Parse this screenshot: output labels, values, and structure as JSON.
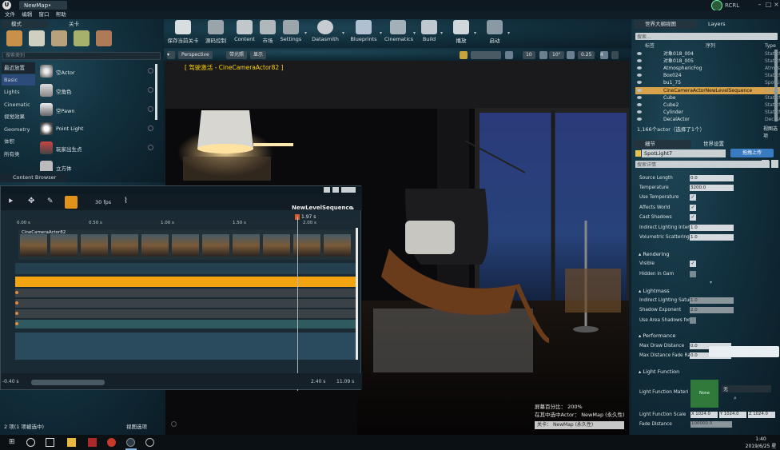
{
  "window": {
    "tab_title": "NewMap•",
    "user": "RCRL",
    "menu": [
      "文件",
      "编辑",
      "窗口",
      "帮助"
    ]
  },
  "modes": {
    "tab_label": "模式",
    "tab2_label": "关卡",
    "search_placeholder": "搜索类别",
    "categories": [
      "最近放置",
      "Basic",
      "Lights",
      "Cinematic",
      "视觉效果",
      "Geometry",
      "体积",
      "所有类"
    ],
    "selected_category": "Basic",
    "items": [
      "空Actor",
      "空角色",
      "空Pawn",
      "Point Light",
      "玩家出生点",
      "立方体"
    ]
  },
  "content_browser": {
    "label": "Content Browser"
  },
  "toolbar": {
    "buttons": [
      "保存当前关卡",
      "源码控制",
      "Content",
      "市场",
      "Settings",
      "Datasmith",
      "Blueprints",
      "Cinematics",
      "Build",
      "播放",
      "启动"
    ]
  },
  "viewport": {
    "perspective": "Perspective",
    "lit": "带光照",
    "show": "显示",
    "cam_label": "[ 驾驶激活 - CineCameraActor82 ]",
    "grid_snap": "10",
    "rot_snap": "10°",
    "scale_snap": "0.25",
    "cam_speed": "4",
    "screen_pct_label": "屏幕百分比：",
    "screen_pct": "200%",
    "selected_label": "在其中选中Actor：",
    "selected_map": "NewMap (永久性)",
    "level_label": "关卡：",
    "level_value": "NewMap (永久性)"
  },
  "sequencer": {
    "name": "NewLevelSequence",
    "fps": "30 fps",
    "time_marker": "1.97 s",
    "ruler": [
      "0.00 s",
      "0.50 s",
      "1.00 s",
      "1.50 s",
      "2.00 s"
    ],
    "track_label": "CineCameraActor82",
    "bottom_left": "-0.40 s",
    "bottom_mid": "2.40 s",
    "bottom_right": "11.09 s",
    "sel_count": "2 项(1 项被选中)",
    "view_options": "视图选项"
  },
  "outliner": {
    "tab": "世界大纲视图",
    "layers_tab": "Layers",
    "search_placeholder": "搜索...",
    "col_label": "标签",
    "col_seq": "序列",
    "col_type": "Type",
    "rows": [
      {
        "name": "对象018_004",
        "type": "StaticM"
      },
      {
        "name": "对象018_005",
        "type": "StaticM"
      },
      {
        "name": "AtmosphericFog",
        "type": "Atmosph"
      },
      {
        "name": "Box024",
        "type": "StaticM"
      },
      {
        "name": "bu1_75",
        "type": "SpotLi"
      },
      {
        "name": "CineCameraActorNewLevelSequence",
        "type": "CineCa"
      },
      {
        "name": "Cube",
        "type": "StaticM"
      },
      {
        "name": "Cube2",
        "type": "StaticM"
      },
      {
        "name": "Cylinder",
        "type": "StaticM"
      },
      {
        "name": "DecalActor",
        "type": "DecalA"
      }
    ],
    "count": "1,166个actor（选择了1个）",
    "view_options": "视图选项"
  },
  "details": {
    "tab": "细节",
    "world_tab": "世界设置",
    "actor_name": "SpotLight7",
    "upload_btn": "拖拽上传",
    "search_placeholder": "搜索详情",
    "props": [
      {
        "label": "Source Length",
        "value": "0.0"
      },
      {
        "label": "Temperature",
        "value": "3200.0"
      },
      {
        "label": "Use Temperature",
        "check": "✓"
      },
      {
        "label": "Affects World",
        "check": "✓"
      },
      {
        "label": "Cast Shadows",
        "check": "✓"
      },
      {
        "label": "Indirect Lighting Intens",
        "value": "1.0"
      },
      {
        "label": "Volumetric Scattering I",
        "value": "1.0"
      }
    ],
    "rendering": "Rendering",
    "visible": "Visible",
    "hidden_in_game": "Hidden in Gam",
    "lightmass": "Lightmass",
    "lm_props": [
      "Indirect Lighting Satura",
      "Shadow Exponent",
      "Use Area Shadows for S"
    ],
    "lm_values": [
      "1.0",
      "2.0"
    ],
    "performance": "Performance",
    "perf_props": [
      {
        "label": "Max Draw Distance",
        "value": "0.0"
      },
      {
        "label": "Max Distance Fade Ran",
        "value": "0.0"
      }
    ],
    "light_function": "Light Function",
    "lf_material": "Light Function Materi",
    "lf_none": "None",
    "lf_none_text": "无",
    "lf_scale": "Light Function Scale",
    "lf_scale_x": "X 1024.0",
    "lf_scale_y": "Y 1024.0",
    "lf_scale_z": "Z 1024.0",
    "fade_distance": "Fade Distance",
    "fade_value": "100000.0"
  },
  "taskbar": {
    "time": "1:40",
    "date": "2019/6/25 星期二"
  }
}
